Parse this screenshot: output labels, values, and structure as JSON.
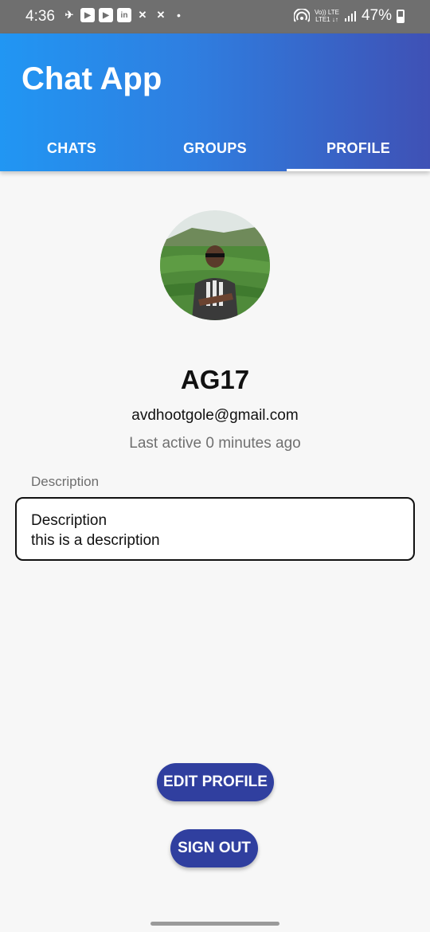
{
  "status_bar": {
    "time": "4:36",
    "left_icons": [
      "chat-bubbles-icon",
      "youtube-icon",
      "youtube-icon",
      "linkedin-icon",
      "x-icon",
      "x-icon",
      "dot-icon"
    ],
    "network_label_top": "Vo)) LTE",
    "network_label_bottom": "LTE1 ↓↑",
    "battery": "47%"
  },
  "app_bar": {
    "title": "Chat App",
    "tabs": [
      {
        "label": "CHATS",
        "active": false
      },
      {
        "label": "GROUPS",
        "active": false
      },
      {
        "label": "PROFILE",
        "active": true
      }
    ],
    "gradient_start": "#2196f3",
    "gradient_end": "#3f51b5"
  },
  "profile": {
    "username": "AG17",
    "email": "avdhootgole@gmail.com",
    "last_active": "Last active 0 minutes ago",
    "description_label": "Description",
    "description_line1": "Description",
    "description_line2": "this is a description"
  },
  "actions": {
    "edit_label": "EDIT PROFILE",
    "signout_label": "SIGN OUT",
    "button_color": "#303f9f"
  }
}
